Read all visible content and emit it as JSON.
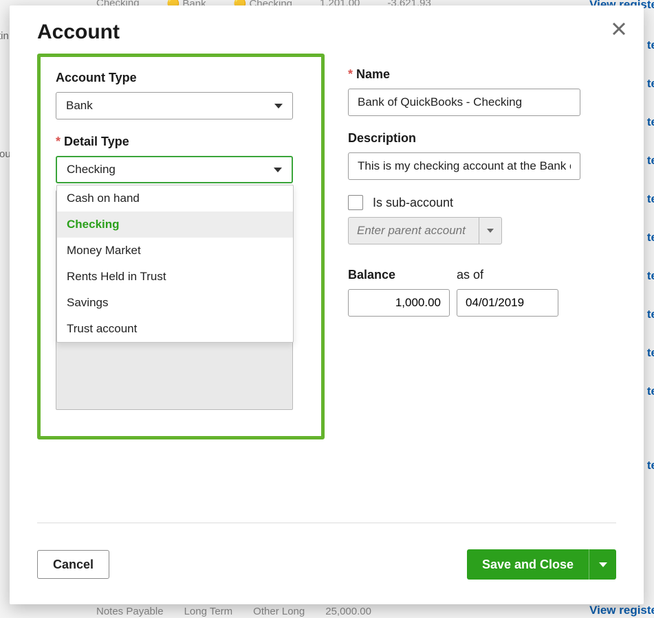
{
  "bg": {
    "top": {
      "col1": "Checking",
      "col2": "Bank",
      "col3": "Checking",
      "col4": "1,201.00",
      "col5": "-3,621.93",
      "link": "View registe"
    },
    "links_right": [
      "te",
      "te",
      "te",
      "te",
      "te",
      "te",
      "te",
      "te",
      "te",
      "te",
      "te"
    ],
    "bottom": {
      "c1": "Notes Payable",
      "c2": "Long Term",
      "c3": "Other Long",
      "c4": "25,000.00",
      "link": "View registe"
    },
    "left_frag": "tin",
    "ou": "ou"
  },
  "modal": {
    "title": "Account",
    "accountType": {
      "label": "Account Type",
      "value": "Bank"
    },
    "detailType": {
      "label": "Detail Type",
      "value": "Checking",
      "options": [
        "Cash on hand",
        "Checking",
        "Money Market",
        "Rents Held in Trust",
        "Savings",
        "Trust account"
      ],
      "selected": "Checking"
    },
    "name": {
      "label": "Name",
      "value": "Bank of QuickBooks - Checking"
    },
    "description": {
      "label": "Description",
      "value": "This is my checking account at the Bank of"
    },
    "subaccount": {
      "label": "Is sub-account",
      "placeholder": "Enter parent account"
    },
    "balance": {
      "label": "Balance",
      "value": "1,000.00"
    },
    "asof": {
      "label": "as of",
      "value": "04/01/2019"
    },
    "buttons": {
      "cancel": "Cancel",
      "save": "Save and Close"
    }
  }
}
